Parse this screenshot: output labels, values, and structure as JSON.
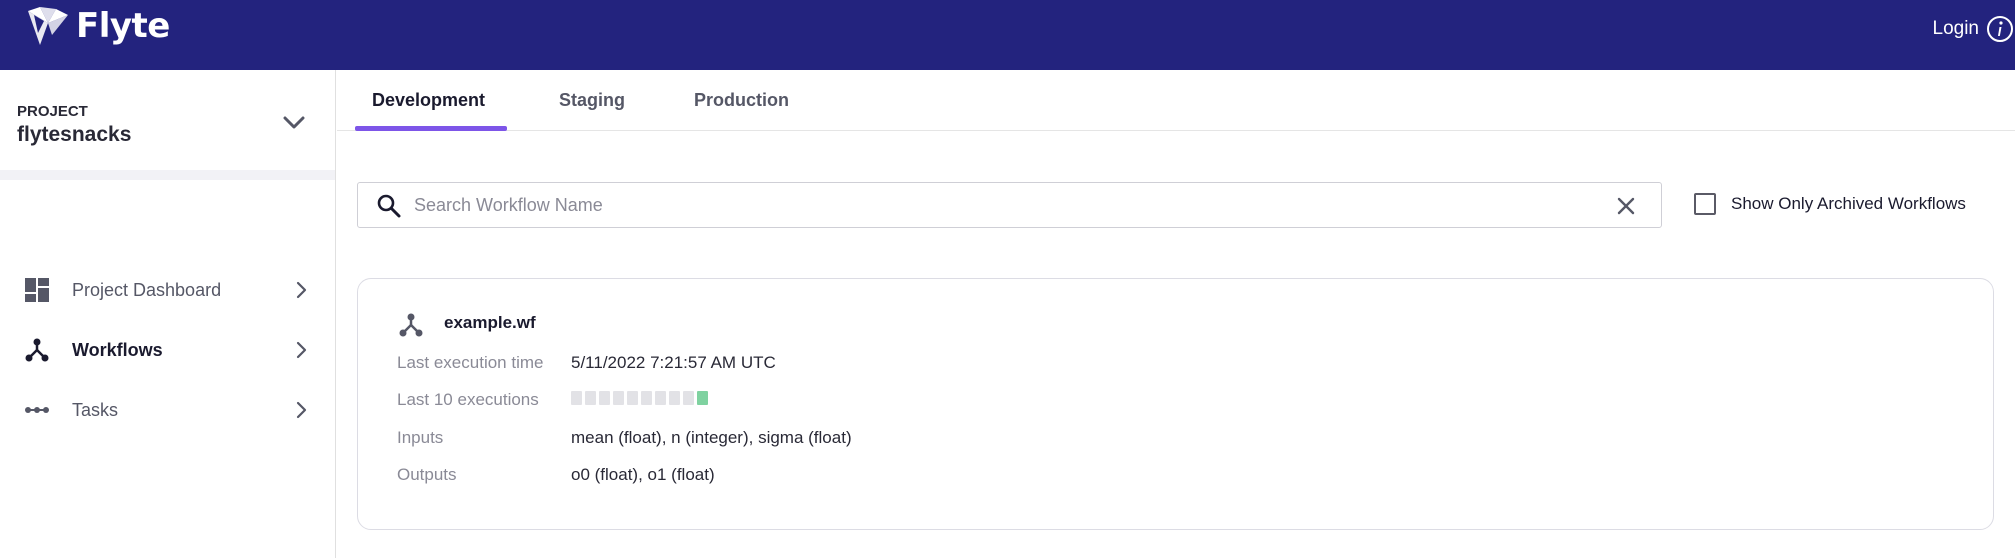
{
  "header": {
    "brand": "Flyte",
    "login_label": "Login",
    "login_icon": "info-icon",
    "background_color": "#23237e"
  },
  "sidebar": {
    "project_label": "PROJECT",
    "project_name": "flytesnacks",
    "items": [
      {
        "label": "Project Dashboard",
        "icon": "dashboard-icon",
        "active": false
      },
      {
        "label": "Workflows",
        "icon": "workflow-icon",
        "active": true
      },
      {
        "label": "Tasks",
        "icon": "tasks-icon",
        "active": false
      }
    ]
  },
  "tabs": {
    "items": [
      {
        "label": "Development",
        "active": true
      },
      {
        "label": "Staging",
        "active": false
      },
      {
        "label": "Production",
        "active": false
      }
    ],
    "accent_color": "#7d55e8"
  },
  "search": {
    "placeholder": "Search Workflow Name",
    "value": ""
  },
  "archive_filter": {
    "label": "Show Only Archived Workflows",
    "checked": false
  },
  "workflow": {
    "name": "example.wf",
    "rows": {
      "last_execution_label": "Last execution time",
      "last_execution_value": "5/11/2022 7:21:57 AM UTC",
      "last_executions_label": "Last 10 executions",
      "inputs_label": "Inputs",
      "inputs_value": "mean (float), n (integer), sigma (float)",
      "outputs_label": "Outputs",
      "outputs_value": "o0 (float), o1 (float)"
    },
    "executions": [
      "none",
      "none",
      "none",
      "none",
      "none",
      "none",
      "none",
      "none",
      "none",
      "succeeded"
    ],
    "status_colors": {
      "succeeded": "#7fd2a0",
      "none": "#e2e2e6"
    }
  }
}
